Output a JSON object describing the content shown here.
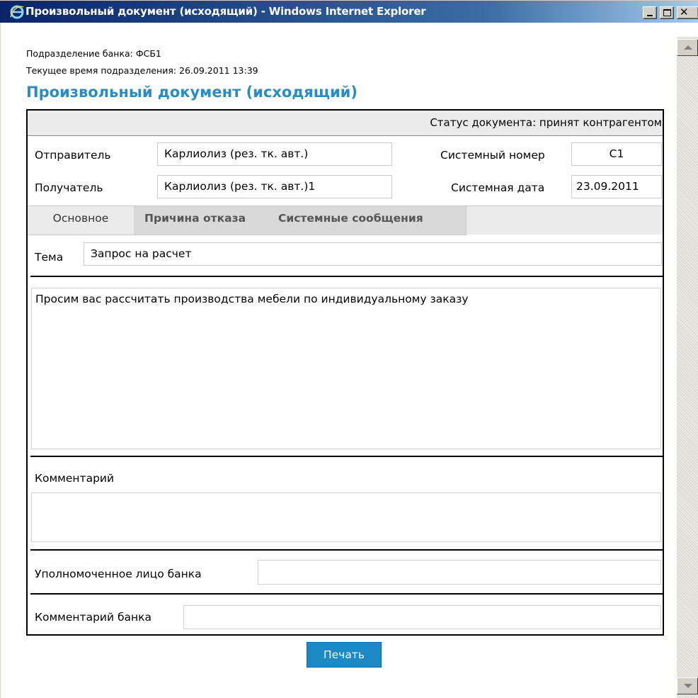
{
  "window": {
    "title": "Произвольный документ (исходящий) - Windows Internet Explorer"
  },
  "header": {
    "branch": "Подразделение банка: ФСБ1",
    "current_time": "Текущее время подразделения: 26.09.2011 13:39",
    "doc_title": "Произвольный документ (исходящий)"
  },
  "status": {
    "text": "Статус документа: принят контрагентом"
  },
  "fields": {
    "sender_label": "Отправитель",
    "sender_value": "Карлиолиз (рез. тк. авт.)",
    "receiver_label": "Получатель",
    "receiver_value": "Карлиолиз (рез. тк. авт.)1",
    "sysnum_label": "Системный номер",
    "sysnum_value": "С1",
    "sysdate_label": "Системная дата",
    "sysdate_value": "23.09.2011"
  },
  "tabs": [
    {
      "label": "Основное",
      "active": true
    },
    {
      "label": "Причина отказа",
      "active": false
    },
    {
      "label": "Системные сообщения",
      "active": false
    }
  ],
  "main": {
    "topic_label": "Тема",
    "topic_value": "Запрос на расчет",
    "body_text": "Просим вас рассчитать производства мебели по индивидуальному заказу",
    "comment_label": "Комментарий",
    "comment_value": "",
    "bank_person_label": "Уполномоченное лицо банка",
    "bank_person_value": "",
    "bank_comment_label": "Комментарий банка",
    "bank_comment_value": ""
  },
  "actions": {
    "print_label": "Печать"
  },
  "colors": {
    "title_accent": "#2a8cc4",
    "button_bg": "#1c88c4",
    "titlebar": "#0a246a"
  },
  "icons": [
    "ie-icon",
    "minimize-icon",
    "maximize-icon",
    "close-icon",
    "scroll-up-icon",
    "scroll-down-icon"
  ]
}
